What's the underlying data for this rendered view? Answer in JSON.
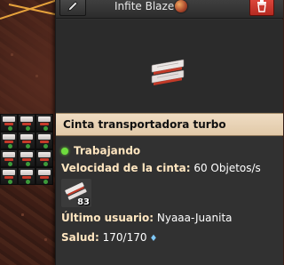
{
  "header": {
    "title": "Infite Blaze",
    "planet_icon": "planet-icon",
    "edit_icon": "pencil-icon",
    "delete_icon": "trash-icon",
    "delete_color": "#d8372d"
  },
  "entity": {
    "name": "Cinta transportadora turbo",
    "status": "Trabajando",
    "status_color": "#6fdc3e",
    "speed_label": "Velocidad de la cinta:",
    "speed_value": "60 Objetos/s",
    "inventory_count": "83",
    "last_user_label": "Último usuario:",
    "last_user_value": "Nyaaa-Juanita",
    "health_label": "Salud:",
    "health_value": "170/170",
    "health_icon": "shield-icon"
  },
  "colors": {
    "title_bar": "#e6d1b3",
    "panel": "#313131",
    "accent_text": "#ffe6c0"
  }
}
